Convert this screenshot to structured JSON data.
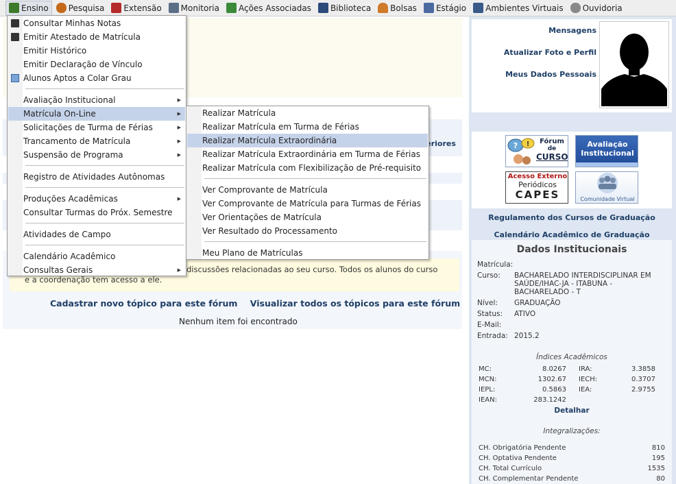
{
  "menubar": {
    "items": [
      {
        "label": "Ensino",
        "icon": "books-icon",
        "color": "#3d7a2a"
      },
      {
        "label": "Pesquisa",
        "icon": "flask-icon",
        "color": "#c46a1a"
      },
      {
        "label": "Extensão",
        "icon": "handshake-icon",
        "color": "#b52a2a"
      },
      {
        "label": "Monitoria",
        "icon": "monitor-icon",
        "color": "#5a6e86"
      },
      {
        "label": "Ações Associadas",
        "icon": "puzzle-icon",
        "color": "#3a8a3a"
      },
      {
        "label": "Biblioteca",
        "icon": "library-icon",
        "color": "#2c4a7a"
      },
      {
        "label": "Bolsas",
        "icon": "person-icon",
        "color": "#d07a2a"
      },
      {
        "label": "Estágio",
        "icon": "certificate-icon",
        "color": "#4a6aa0"
      },
      {
        "label": "Ambientes Virtuais",
        "icon": "people-icon",
        "color": "#3a5a8a"
      },
      {
        "label": "Ouvidoria",
        "icon": "ouvidoria-icon",
        "color": "#888888"
      }
    ]
  },
  "ensino_menu": {
    "items": [
      {
        "label": "Consultar Minhas Notas"
      },
      {
        "label": "Emitir Atestado de Matrícula"
      },
      {
        "label": "Emitir Histórico"
      },
      {
        "label": "Emitir Declaração de Vínculo"
      },
      {
        "label": "Alunos Aptos a Colar Grau"
      },
      {
        "label": "Avaliação Institucional"
      },
      {
        "label": "Matrícula On-Line"
      },
      {
        "label": "Solicitações de Turma de Férias"
      },
      {
        "label": "Trancamento de Matrícula"
      },
      {
        "label": "Suspensão de Programa"
      },
      {
        "label": "Registro de Atividades Autônomas"
      },
      {
        "label": "Produções Acadêmicas"
      },
      {
        "label": "Consultar Turmas do Próx. Semestre"
      },
      {
        "label": "Atividades de Campo"
      },
      {
        "label": "Calendário Acadêmico"
      },
      {
        "label": "Consultas Gerais"
      }
    ]
  },
  "matricula_menu": {
    "items": [
      {
        "label": "Realizar Matrícula"
      },
      {
        "label": "Realizar Matrícula em Turma de Férias"
      },
      {
        "label": "Realizar Matrícula Extraordinária"
      },
      {
        "label": "Realizar Matrícula Extraordinária em Turma de Férias"
      },
      {
        "label": "Realizar Matrícula com Flexibilização de Pré-requisito"
      },
      {
        "label": "Ver Comprovante de Matrícula"
      },
      {
        "label": "Ver Comprovante de Matrícula para Turmas de Férias"
      },
      {
        "label": "Ver Orientações de Matrícula"
      },
      {
        "label": "Ver Resultado do Processamento"
      },
      {
        "label": "Meu Plano de Matrículas"
      }
    ]
  },
  "main": {
    "hidden_link_fragment": "teriores",
    "forum": {
      "description": "discussões relacionadas ao seu curso. Todos os alunos do curso e a coordenação tem acesso a ele.",
      "description_line1": "discussões relacionadas ao seu curso. Todos os alunos do curso",
      "description_line2": "e a coordenação tem acesso a ele.",
      "new_topic_link": "Cadastrar novo tópico para este fórum",
      "view_all_link": "Visualizar todos os tópicos para este fórum",
      "empty_message": "Nenhum item foi encontrado"
    }
  },
  "sidebar": {
    "profile_links": [
      "Mensagens",
      "Atualizar Foto e Perfil",
      "Meus Dados Pessoais"
    ],
    "banners": [
      {
        "name": "forum-curso-banner",
        "line1": "Fórum",
        "line2": "de",
        "line3": "CURSO"
      },
      {
        "name": "avaliacao-institucional-banner",
        "line1": "Avaliação",
        "line2": "Institucional"
      },
      {
        "name": "capes-banner",
        "line1": "Acesso Externo",
        "line2": "Periódicos",
        "line3": "CAPES"
      },
      {
        "name": "comunidade-virtual-banner",
        "line1": "Comunidade Virtual"
      }
    ],
    "regulamento_link": "Regulamento dos Cursos de Graduação",
    "calendario_link": "Calendário Acadêmico de Graduação",
    "dados": {
      "title": "Dados Institucionais",
      "matricula_label": "Matrícula:",
      "matricula_value": "",
      "curso_label": "Curso:",
      "curso_line1": "BACHARELADO INTERDISCIPLINAR EM",
      "curso_line2": "SAÚDE/IHAC-JA - ITABUNA -",
      "curso_line3": "BACHARELADO - T",
      "nivel_label": "Nível:",
      "nivel_value": "GRADUAÇÃO",
      "status_label": "Status:",
      "status_value": "ATIVO",
      "email_label": "E-Mail:",
      "email_value": "",
      "entrada_label": "Entrada:",
      "entrada_value": "2015.2"
    },
    "indices": {
      "title": "Índices Acadêmicos",
      "left": [
        {
          "label": "MC:",
          "value": "8.0267"
        },
        {
          "label": "MCN:",
          "value": "1302.67"
        },
        {
          "label": "IEPL:",
          "value": "0.5863"
        },
        {
          "label": "IEAN:",
          "value": "283.1242"
        }
      ],
      "right": [
        {
          "label": "IRA:",
          "value": "3.3858"
        },
        {
          "label": "IECH:",
          "value": "0.3707"
        },
        {
          "label": "IEA:",
          "value": "2.9755"
        }
      ],
      "detail_link": "Detalhar"
    },
    "integralizacoes": {
      "title": "Integralizações:",
      "rows": [
        {
          "label": "CH. Obrigatória Pendente",
          "value": "810"
        },
        {
          "label": "CH. Optativa Pendente",
          "value": "195"
        },
        {
          "label": "CH. Total Currículo",
          "value": "1535"
        },
        {
          "label": "CH. Complementar Pendente",
          "value": "80"
        }
      ]
    }
  }
}
